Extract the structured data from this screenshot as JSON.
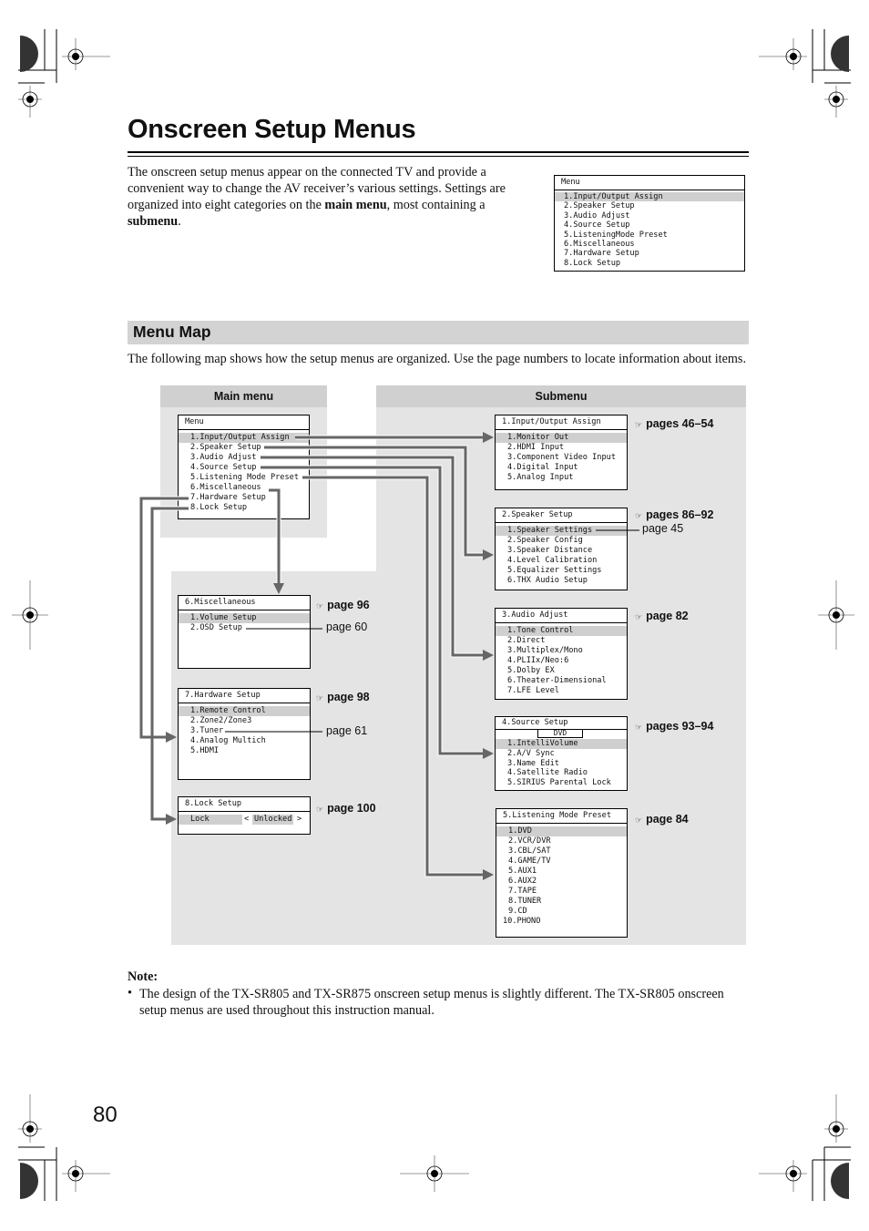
{
  "page": {
    "title": "Onscreen Setup Menus",
    "number": "80"
  },
  "intro": {
    "text_1": "The onscreen setup menus appear on the connected TV and provide a convenient way to change the AV receiver’s various settings. Settings are organized into eight categories on the ",
    "bold_1": "main menu",
    "text_2": ", most containing a ",
    "bold_2": "submenu",
    "text_3": "."
  },
  "preview_menu": {
    "header": "Menu",
    "items": [
      "1.Input/Output Assign",
      "2.Speaker Setup",
      "3.Audio Adjust",
      "4.Source Setup",
      "5.ListeningMode Preset",
      "6.Miscellaneous",
      "7.Hardware Setup",
      "8.Lock Setup"
    ],
    "selected_index": 0
  },
  "section": {
    "title": "Menu Map",
    "description": "The following map shows how the setup menus are organized. Use the page numbers to locate information about items."
  },
  "map": {
    "main_header": "Main menu",
    "sub_header": "Submenu",
    "main_menu": {
      "header": "Menu",
      "items": [
        "1.Input/Output Assign",
        "2.Speaker Setup",
        "3.Audio Adjust",
        "4.Source Setup",
        "5.Listening Mode Preset",
        "6.Miscellaneous",
        "7.Hardware Setup",
        "8.Lock Setup"
      ],
      "selected_index": 0
    },
    "submenus": [
      {
        "header": "1.Input/Output Assign",
        "items": [
          "1.Monitor Out",
          "2.HDMI Input",
          "3.Component Video Input",
          "4.Digital Input",
          "5.Analog Input"
        ],
        "ref": "pages 46–54"
      },
      {
        "header": "2.Speaker Setup",
        "items": [
          "1.Speaker Settings",
          "2.Speaker Config",
          "3.Speaker Distance",
          "4.Level Calibration",
          "5.Equalizer Settings",
          "6.THX Audio Setup"
        ],
        "ref": "pages 86–92",
        "extra_ref": "page 45"
      },
      {
        "header": "3.Audio Adjust",
        "items": [
          "1.Tone Control",
          "2.Direct",
          "3.Multiplex/Mono",
          "4.PLIIx/Neo:6",
          "5.Dolby EX",
          "6.Theater-Dimensional",
          "7.LFE Level"
        ],
        "ref": "page 82"
      },
      {
        "header": "4.Source Setup",
        "source_value": "DVD",
        "items": [
          "1.IntelliVolume",
          "2.A/V Sync",
          "3.Name Edit",
          "4.Satellite Radio",
          "5.SIRIUS Parental Lock"
        ],
        "ref": "pages 93–94"
      },
      {
        "header": "5.Listening Mode Preset",
        "items": [
          "1.DVD",
          "2.VCR/DVR",
          "3.CBL/SAT",
          "4.GAME/TV",
          "5.AUX1",
          "6.AUX2",
          "7.TAPE",
          "8.TUNER",
          "9.CD",
          "10.PHONO"
        ],
        "ref": "page 84"
      },
      {
        "header": "6.Miscellaneous",
        "items": [
          "1.Volume Setup",
          "2.OSD Setup"
        ],
        "ref": "page 96",
        "extra_ref": "page 60"
      },
      {
        "header": "7.Hardware Setup",
        "items": [
          "1.Remote Control",
          "2.Zone2/Zone3",
          "3.Tuner",
          "4.Analog Multich",
          "5.HDMI"
        ],
        "ref": "page 98",
        "extra_ref": "page 61"
      },
      {
        "header": "8.Lock Setup",
        "lock_label": "Lock",
        "lock_value": "Unlocked",
        "lt": "<",
        "gt": ">",
        "ref": "page 100"
      }
    ],
    "ref_icon": "pointing-hand-icon",
    "ref_glyph": "☞"
  },
  "note": {
    "title": "Note:",
    "bullet": "•",
    "text": "The design of the TX-SR805 and TX-SR875 onscreen setup menus is slightly different. The TX-SR805 onscreen setup menus are used throughout this instruction manual."
  },
  "colors": {
    "panel": "#e4e4e4",
    "panel_header": "#d0d0d0",
    "selection": "#cfcfcf",
    "connector": "#666666"
  }
}
